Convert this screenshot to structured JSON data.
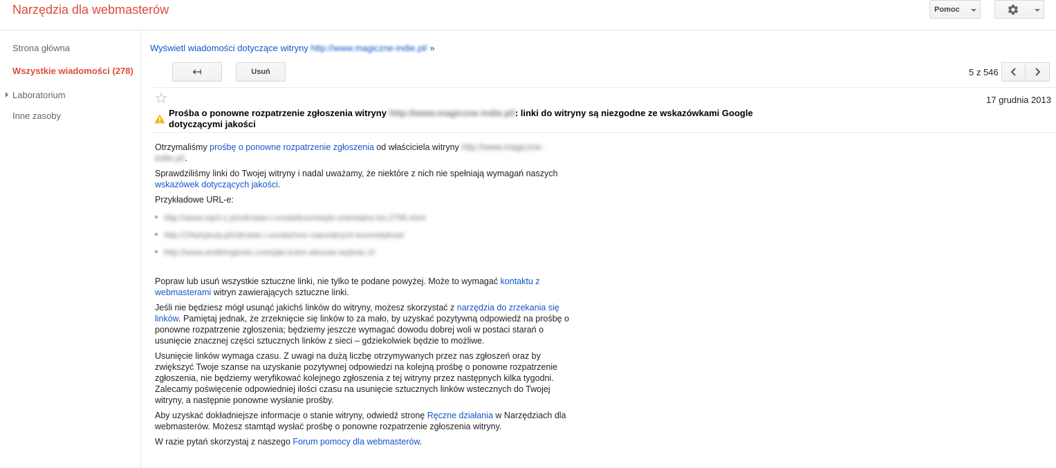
{
  "header": {
    "title": "Narzędzia dla webmasterów",
    "help_label": "Pomoc"
  },
  "sidebar": {
    "items": [
      {
        "label": "Strona główna"
      },
      {
        "label": "Wszystkie wiadomości (278)"
      },
      {
        "label": "Laboratorium"
      },
      {
        "label": "Inne zasoby"
      }
    ]
  },
  "toolbar": {
    "view_messages_label": "Wyświetl wiadomości dotyczące witryny",
    "site_url": "http://www.magiczne-indie.pl/",
    "view_messages_arrow": "»",
    "back_icon_glyph": "↤",
    "delete_label": "Usuń",
    "page_count": "5 z 546"
  },
  "message": {
    "date": "17 grudnia 2013",
    "subject_prefix": "Prośba o ponowne rozpatrzenie zgłoszenia witryny",
    "subject_site": "http://www.magiczne-indie.pl/",
    "subject_suffix": ": linki do witryny są niezgodne ze wskazówkami Google dotyczącymi jakości",
    "p1_a": "Otrzymaliśmy ",
    "p1_link": "prośbę o ponowne rozpatrzenie zgłoszenia",
    "p1_b": " od właściciela witryny ",
    "p1_site": "http://www.magiczne-indie.pl/",
    "p1_end": ".",
    "p2_a": "Sprawdziliśmy linki do Twojej witryny i nadal uważamy, że niektóre z nich nie spełniają wymagań naszych ",
    "p2_link": "wskazówek dotyczących jakości",
    "p2_end": ".",
    "example_urls_label": "Przykładowe URL-e:",
    "example_urls": [
      "http://www.mp3-z.pl/zdrowie-i-uroda/kosmetyki-orientalne,lov,2795.html",
      "http://24artykuly.pl/zdrowie-i-uroda/moc-naturalnych-kosmetykow/",
      "http://www.smithingtools.com/jaki-kolor-wlosow-wybrac-2/"
    ],
    "p3_a": "Popraw lub usuń wszystkie sztuczne linki, nie tylko te podane powyżej. Może to wymagać ",
    "p3_link": "kontaktu z webmasterami",
    "p3_b": " witryn zawierających sztuczne linki.",
    "p4_a": "Jeśli nie będziesz mógł usunąć jakichś linków do witryny, możesz skorzystać z ",
    "p4_link": "narzędzia do zrzekania się linków",
    "p4_b": ". Pamiętaj jednak, że zrzeknięcie się linków to za mało, by uzyskać pozytywną odpowiedź na prośbę o ponowne rozpatrzenie zgłoszenia; będziemy jeszcze wymagać dowodu dobrej woli w postaci starań o usunięcie znacznej części sztucznych linków z sieci – gdziekolwiek będzie to możliwe.",
    "p5": "Usunięcie linków wymaga czasu. Z uwagi na dużą liczbę otrzymywanych przez nas zgłoszeń oraz by zwiększyć Twoje szanse na uzyskanie pozytywnej odpowiedzi na kolejną prośbę o ponowne rozpatrzenie zgłoszenia, nie będziemy weryfikować kolejnego zgłoszenia z tej witryny przez następnych kilka tygodni. Zalecamy poświęcenie odpowiedniej ilości czasu na usunięcie sztucznych linków wstecznych do Twojej witryny, a następnie ponowne wysłanie prośby.",
    "p6_a": "Aby uzyskać dokładniejsze informacje o stanie witryny, odwiedź stronę ",
    "p6_link": "Ręczne działania",
    "p6_b": " w Narzędziach dla webmasterów. Możesz stamtąd wysłać prośbę o ponowne rozpatrzenie zgłoszenia witryny.",
    "p7_a": "W razie pytań skorzystaj z naszego ",
    "p7_link": "Forum pomocy dla webmasterów",
    "p7_end": "."
  },
  "colors": {
    "brand": "#dd4b39",
    "link": "#1155cc",
    "warning": "#f4b400"
  },
  "icons": [
    "gear-icon",
    "back-arrow-icon",
    "chevron-left-icon",
    "chevron-right-icon",
    "star-icon",
    "warning-icon"
  ]
}
